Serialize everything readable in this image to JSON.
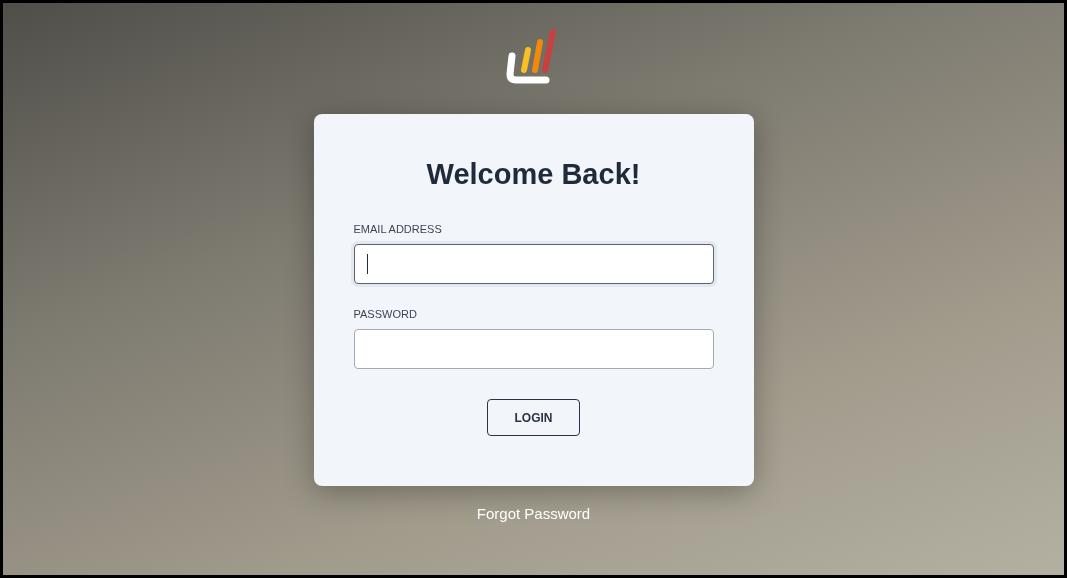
{
  "card": {
    "title": "Welcome Back!",
    "fields": [
      {
        "label": "EMAIL ADDRESS",
        "focused": true
      },
      {
        "label": "PASSWORD",
        "focused": false
      }
    ],
    "button": "LOGIN"
  },
  "forgot_link": "Forgot Password"
}
